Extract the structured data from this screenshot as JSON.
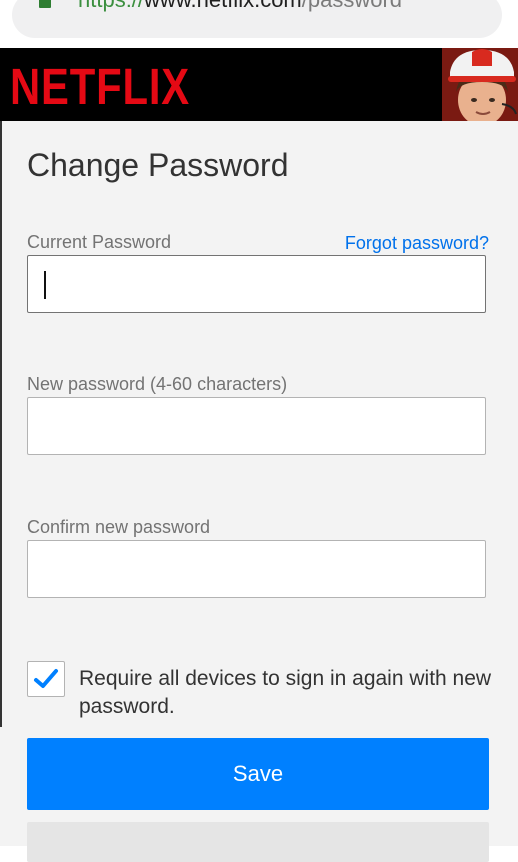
{
  "browser": {
    "url_scheme": "https://",
    "url_host": "www.netflix.com",
    "url_path": "/password",
    "icons": {
      "lock": "lock-icon"
    }
  },
  "header": {
    "logo_text": "NETFLIX",
    "brand_color": "#e50914",
    "avatar": "profile-avatar"
  },
  "form": {
    "title": "Change Password",
    "current_password_label": "Current Password",
    "forgot_link": "Forgot password?",
    "current_password_value": "",
    "new_password_label": "New password (4-60 characters)",
    "new_password_value": "",
    "confirm_password_label": "Confirm new password",
    "confirm_password_value": "",
    "require_signin_checked": true,
    "require_signin_label": "Require all devices to sign in again with new password.",
    "save_label": "Save",
    "accent_color": "#0080ff",
    "link_color": "#0071eb"
  }
}
